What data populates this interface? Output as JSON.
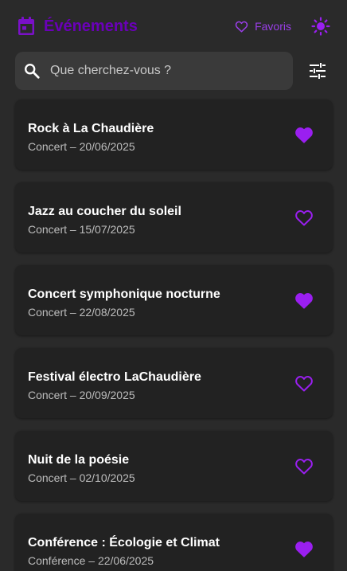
{
  "header": {
    "title": "Événements",
    "favorites_label": "Favoris",
    "calendar_icon": "calendar-icon",
    "theme_icon": "sun-icon"
  },
  "search": {
    "placeholder": "Que cherchez-vous ?",
    "value": "",
    "search_icon": "search-icon",
    "filter_icon": "tune-icon"
  },
  "colors": {
    "accent": "#9a1ff0",
    "title": "#6a00b8",
    "background": "#2a2a2a",
    "card": "#222222"
  },
  "events": [
    {
      "title": "Rock à La Chaudière",
      "subtitle": "Concert – 20/06/2025",
      "favorite": true
    },
    {
      "title": "Jazz au coucher du soleil",
      "subtitle": "Concert – 15/07/2025",
      "favorite": false
    },
    {
      "title": "Concert symphonique nocturne",
      "subtitle": "Concert – 22/08/2025",
      "favorite": true
    },
    {
      "title": "Festival électro LaChaudière",
      "subtitle": "Concert – 20/09/2025",
      "favorite": false
    },
    {
      "title": "Nuit de la poésie",
      "subtitle": "Concert – 02/10/2025",
      "favorite": false
    },
    {
      "title": "Conférence : Écologie et Climat",
      "subtitle": "Conférence – 22/06/2025",
      "favorite": true
    }
  ]
}
